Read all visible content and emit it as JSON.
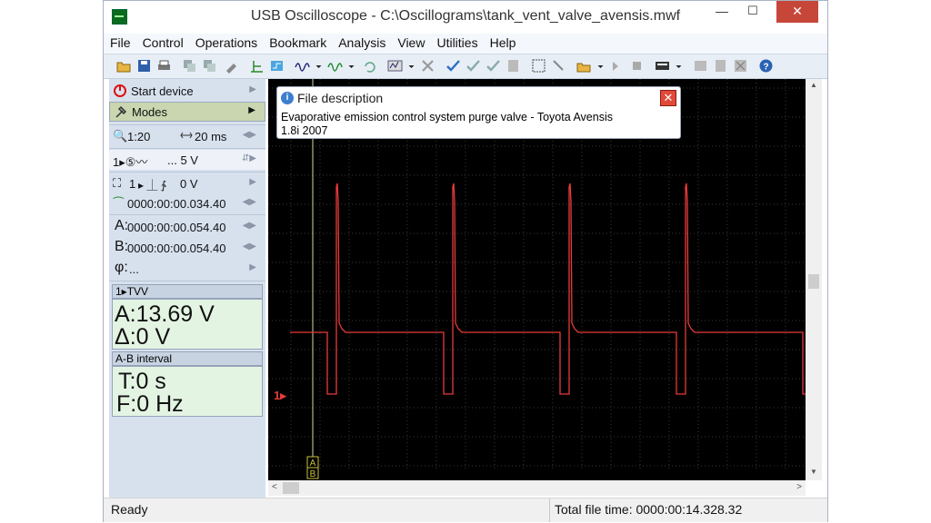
{
  "window": {
    "title": "USB Oscilloscope - C:\\Oscillograms\\tank_vent_valve_avensis.mwf",
    "minimize": "—",
    "maximize": "☐",
    "close": "✕"
  },
  "menu": [
    "File",
    "Control",
    "Operations",
    "Bookmark",
    "Analysis",
    "View",
    "Utilities",
    "Help"
  ],
  "panel": {
    "start_device": "Start device",
    "modes": "Modes",
    "scale": "1:20",
    "timebase": "20 ms",
    "channel_volts": "... 5 V",
    "trigger_channel": "1",
    "trigger_level": "0 V",
    "trigger_time": "0000:00:00.034.40",
    "cursor_a": "0000:00:00.054.40",
    "cursor_b": "0000:00:00.054.40",
    "phi": "...",
    "a_label": "A:",
    "b_label": "B:",
    "phi_label": "φ:"
  },
  "measure": {
    "channel_header": "1▸TVV",
    "a_value": "A:13.69 V",
    "delta_value": "Δ:0 V",
    "interval_header": "A-B interval",
    "t_value": "T:0 s",
    "f_value": "F:0 Hz"
  },
  "popup": {
    "title": "File description",
    "text_line1": "Evaporative emission control system purge valve - Toyota Avensis",
    "text_line2": "1.8i 2007"
  },
  "plot": {
    "channel_marker": "1▸",
    "cursor_a": "A",
    "cursor_b": "B",
    "trace_color": "#e83b3b",
    "grid_color": "#3a3a3a"
  },
  "status": {
    "left": "Ready",
    "right": "Total file time: 0000:00:14.328.32"
  }
}
